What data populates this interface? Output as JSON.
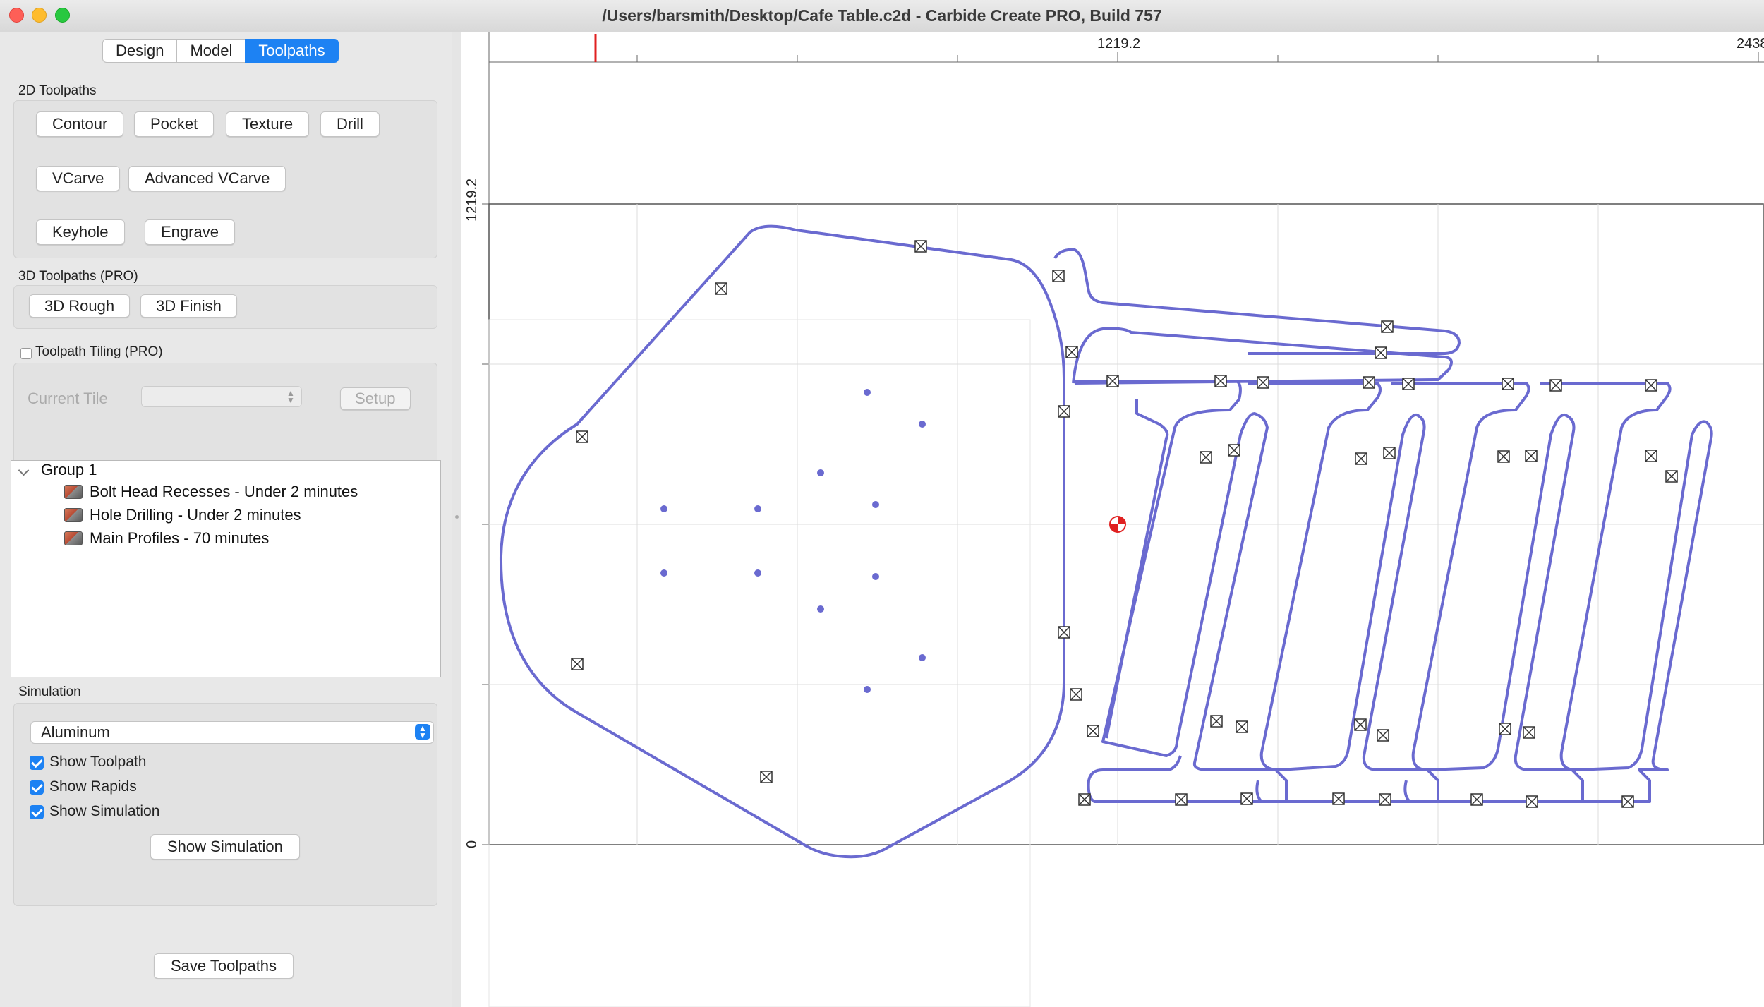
{
  "window": {
    "title": "/Users/barsmith/Desktop/Cafe Table.c2d - Carbide Create PRO, Build 757"
  },
  "tabs": [
    {
      "label": "Design",
      "active": false
    },
    {
      "label": "Model",
      "active": false
    },
    {
      "label": "Toolpaths",
      "active": true
    }
  ],
  "toolpaths_2d": {
    "label": "2D Toolpaths",
    "buttons": [
      "Contour",
      "Pocket",
      "Texture",
      "Drill",
      "VCarve",
      "Advanced VCarve",
      "Keyhole",
      "Engrave"
    ]
  },
  "toolpaths_3d": {
    "label": "3D Toolpaths (PRO)",
    "buttons": [
      "3D Rough",
      "3D Finish"
    ]
  },
  "tiling": {
    "checkbox_label": "Toolpath Tiling (PRO)",
    "checked": false,
    "current_tile_label": "Current Tile",
    "current_tile_value": "",
    "setup_label": "Setup"
  },
  "tree": {
    "group": "Group 1",
    "items": [
      "Bolt Head Recesses - Under 2 minutes",
      "Hole Drilling - Under 2 minutes",
      "Main Profiles - 70 minutes"
    ]
  },
  "simulation": {
    "label": "Simulation",
    "material": "Aluminum",
    "checkboxes": [
      {
        "label": "Show Toolpath",
        "checked": true
      },
      {
        "label": "Show Rapids",
        "checked": true
      },
      {
        "label": "Show Simulation",
        "checked": true
      }
    ],
    "button": "Show Simulation"
  },
  "save_button": "Save Toolpaths",
  "rulers": {
    "x_mid": "1219.2",
    "x_end": "2438",
    "y_mid": "1219.2",
    "y_zero": "0"
  },
  "colors": {
    "accent": "#1d82f3",
    "toolpath": "#6a6ad0",
    "origin_marker": "#e02020"
  }
}
